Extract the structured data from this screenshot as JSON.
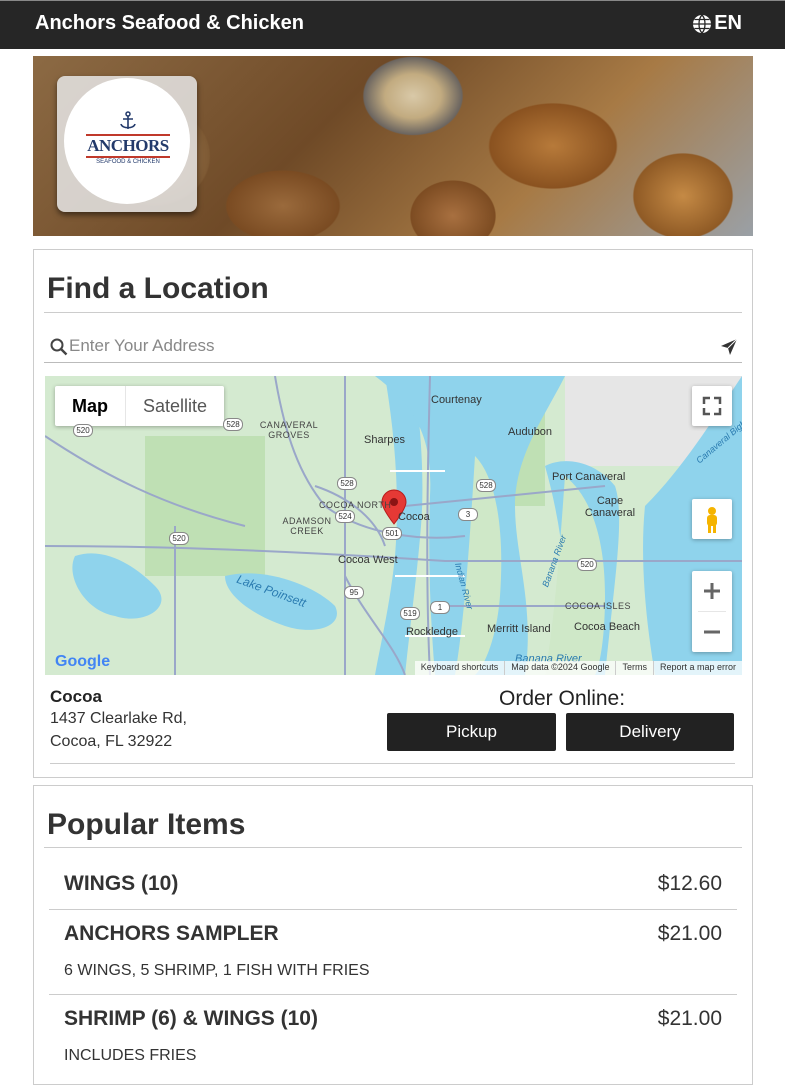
{
  "header": {
    "brand": "Anchors Seafood & Chicken",
    "language": "EN"
  },
  "logo": {
    "name": "ANCHORS",
    "tagline": "SEAFOOD & CHICKEN"
  },
  "location_section": {
    "title": "Find a Location",
    "search_placeholder": "Enter Your Address",
    "map": {
      "tabs": [
        "Map",
        "Satellite"
      ],
      "labels": {
        "courtenay": "Courtenay",
        "audubon": "Audubon",
        "sharpes": "Sharpes",
        "canaveral_groves": "CANAVERAL GROVES",
        "port_canaveral": "Port Canaveral",
        "cape_canaveral": "Cape Canaveral",
        "cocoa_north": "COCOA NORTH",
        "cocoa": "Cocoa",
        "adamson_creek": "ADAMSON CREEK",
        "cocoa_west": "Cocoa West",
        "lake_poinsett": "Lake Poinsett",
        "banana_river": "Banana River",
        "cocoa_isles": "COCOA ISLES",
        "merritt_island": "Merritt Island",
        "cocoa_beach": "Cocoa Beach",
        "rockledge": "Rockledge",
        "indian_river": "Indian River",
        "canaveral_bight": "Canaveral Bight",
        "banana_river_bottom": "Banana River"
      },
      "shields": [
        "520",
        "528",
        "528",
        "528",
        "524",
        "520",
        "501",
        "3",
        "520",
        "95",
        "519",
        "1"
      ],
      "footer": [
        "Keyboard shortcuts",
        "Map data ©2024 Google",
        "Terms",
        "Report a map error"
      ],
      "google": "Google"
    },
    "location": {
      "name": "Cocoa",
      "address_line1": "1437 Clearlake Rd,",
      "address_line2": "Cocoa, FL 32922"
    },
    "order_label": "Order Online:",
    "pickup_label": "Pickup",
    "delivery_label": "Delivery"
  },
  "popular_section": {
    "title": "Popular Items",
    "items": [
      {
        "name": "WINGS (10)",
        "price": "$12.60",
        "desc": ""
      },
      {
        "name": "ANCHORS SAMPLER",
        "price": "$21.00",
        "desc": "6 WINGS, 5 SHRIMP, 1 FISH WITH FRIES"
      },
      {
        "name": "SHRIMP (6) & WINGS (10)",
        "price": "$21.00",
        "desc": "INCLUDES FRIES"
      }
    ]
  },
  "colors": {
    "topbar": "#262626",
    "button": "#222222",
    "map_water": "#8fd3ec",
    "map_land": "#cfe8c8",
    "pin": "#e53935"
  }
}
